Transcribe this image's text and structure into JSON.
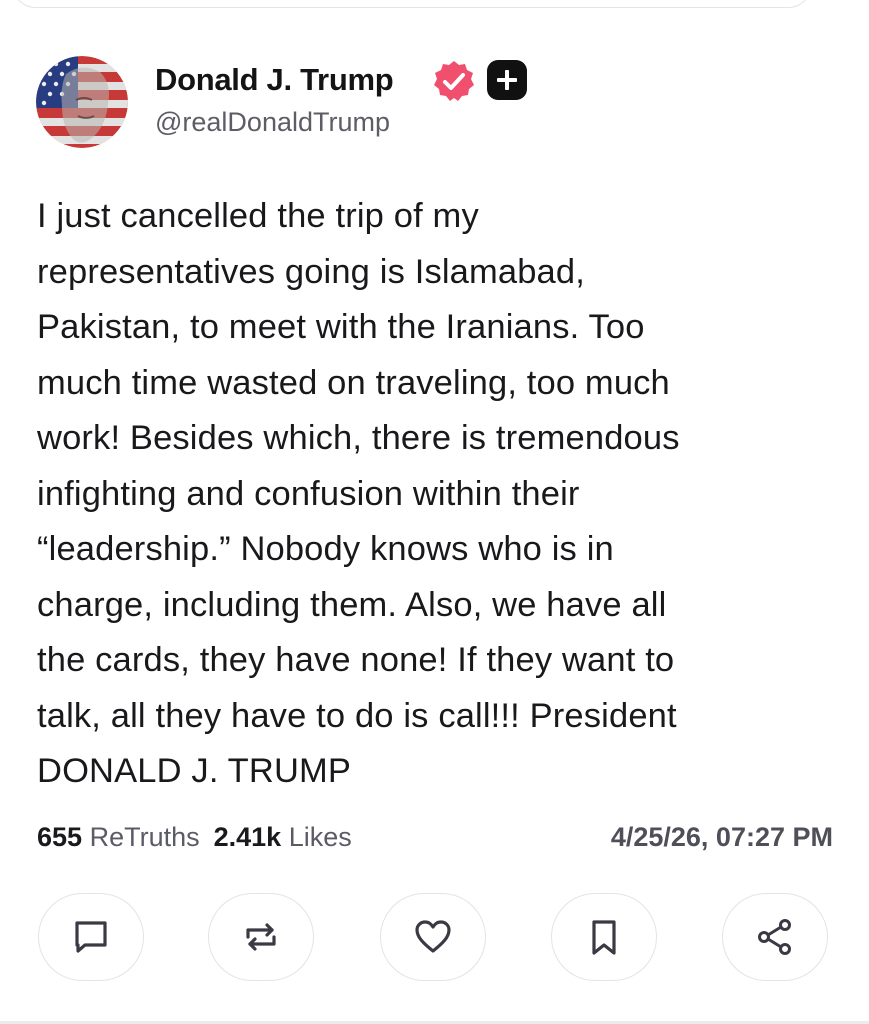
{
  "post": {
    "display_name": "Donald J. Trump",
    "handle": "@realDonaldTrump",
    "body_lines": [
      "I just cancelled the trip of my",
      "representatives going is Islamabad,",
      "Pakistan, to meet with the Iranians. Too",
      "much time wasted on traveling, too much",
      "work! Besides which, there is tremendous",
      "infighting and confusion within their",
      "“leadership.” Nobody knows who is in",
      "charge, including them. Also, we have all",
      "the cards, they have none! If they want to",
      "talk, all they have to do is call!!! President",
      "DONALD J. TRUMP"
    ],
    "retruths_count": "655",
    "retruths_label": "ReTruths",
    "likes_count": "2.41k",
    "likes_label": "Likes",
    "timestamp": "4/25/26, 07:27 PM"
  },
  "icons": {
    "verified": "verified-badge-icon",
    "plus": "truth-plus-icon",
    "reply": "comment-icon",
    "retruth": "repost-icon",
    "like": "heart-icon",
    "bookmark": "bookmark-icon",
    "share": "share-icon"
  },
  "colors": {
    "verified_badge": "#f0506e",
    "text_primary": "#19191c",
    "text_secondary": "#5d5d66",
    "button_border": "#e3e3e8"
  }
}
